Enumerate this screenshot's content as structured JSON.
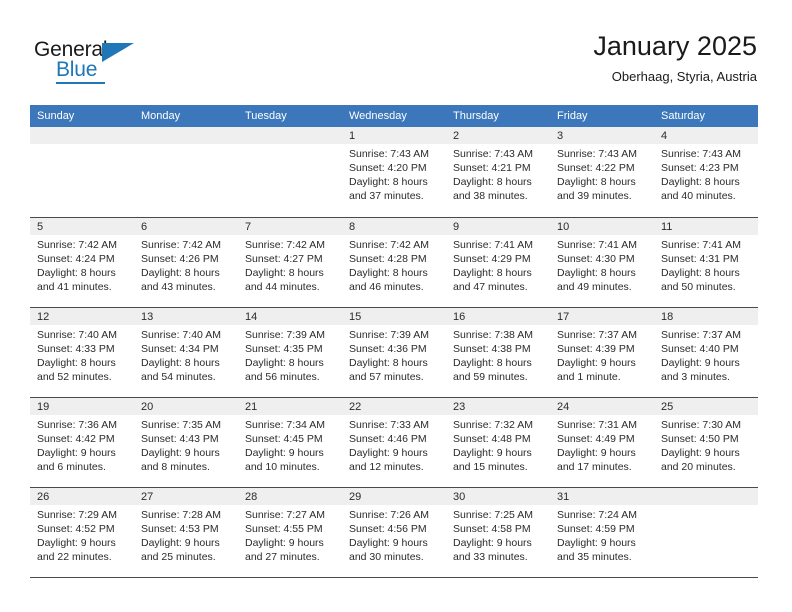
{
  "brand": {
    "name_part1": "General",
    "name_part2": "Blue",
    "logo_icon": "triangle-flag-icon",
    "accent_color": "#2077b8"
  },
  "header": {
    "title": "January 2025",
    "location": "Oberhaag, Styria, Austria",
    "header_bg_color": "#3b77ba"
  },
  "calendar": {
    "weekday_headers": [
      "Sunday",
      "Monday",
      "Tuesday",
      "Wednesday",
      "Thursday",
      "Friday",
      "Saturday"
    ],
    "weeks": [
      [
        {
          "day": "",
          "lines": []
        },
        {
          "day": "",
          "lines": []
        },
        {
          "day": "",
          "lines": []
        },
        {
          "day": "1",
          "lines": [
            "Sunrise: 7:43 AM",
            "Sunset: 4:20 PM",
            "Daylight: 8 hours",
            "and 37 minutes."
          ]
        },
        {
          "day": "2",
          "lines": [
            "Sunrise: 7:43 AM",
            "Sunset: 4:21 PM",
            "Daylight: 8 hours",
            "and 38 minutes."
          ]
        },
        {
          "day": "3",
          "lines": [
            "Sunrise: 7:43 AM",
            "Sunset: 4:22 PM",
            "Daylight: 8 hours",
            "and 39 minutes."
          ]
        },
        {
          "day": "4",
          "lines": [
            "Sunrise: 7:43 AM",
            "Sunset: 4:23 PM",
            "Daylight: 8 hours",
            "and 40 minutes."
          ]
        }
      ],
      [
        {
          "day": "5",
          "lines": [
            "Sunrise: 7:42 AM",
            "Sunset: 4:24 PM",
            "Daylight: 8 hours",
            "and 41 minutes."
          ]
        },
        {
          "day": "6",
          "lines": [
            "Sunrise: 7:42 AM",
            "Sunset: 4:26 PM",
            "Daylight: 8 hours",
            "and 43 minutes."
          ]
        },
        {
          "day": "7",
          "lines": [
            "Sunrise: 7:42 AM",
            "Sunset: 4:27 PM",
            "Daylight: 8 hours",
            "and 44 minutes."
          ]
        },
        {
          "day": "8",
          "lines": [
            "Sunrise: 7:42 AM",
            "Sunset: 4:28 PM",
            "Daylight: 8 hours",
            "and 46 minutes."
          ]
        },
        {
          "day": "9",
          "lines": [
            "Sunrise: 7:41 AM",
            "Sunset: 4:29 PM",
            "Daylight: 8 hours",
            "and 47 minutes."
          ]
        },
        {
          "day": "10",
          "lines": [
            "Sunrise: 7:41 AM",
            "Sunset: 4:30 PM",
            "Daylight: 8 hours",
            "and 49 minutes."
          ]
        },
        {
          "day": "11",
          "lines": [
            "Sunrise: 7:41 AM",
            "Sunset: 4:31 PM",
            "Daylight: 8 hours",
            "and 50 minutes."
          ]
        }
      ],
      [
        {
          "day": "12",
          "lines": [
            "Sunrise: 7:40 AM",
            "Sunset: 4:33 PM",
            "Daylight: 8 hours",
            "and 52 minutes."
          ]
        },
        {
          "day": "13",
          "lines": [
            "Sunrise: 7:40 AM",
            "Sunset: 4:34 PM",
            "Daylight: 8 hours",
            "and 54 minutes."
          ]
        },
        {
          "day": "14",
          "lines": [
            "Sunrise: 7:39 AM",
            "Sunset: 4:35 PM",
            "Daylight: 8 hours",
            "and 56 minutes."
          ]
        },
        {
          "day": "15",
          "lines": [
            "Sunrise: 7:39 AM",
            "Sunset: 4:36 PM",
            "Daylight: 8 hours",
            "and 57 minutes."
          ]
        },
        {
          "day": "16",
          "lines": [
            "Sunrise: 7:38 AM",
            "Sunset: 4:38 PM",
            "Daylight: 8 hours",
            "and 59 minutes."
          ]
        },
        {
          "day": "17",
          "lines": [
            "Sunrise: 7:37 AM",
            "Sunset: 4:39 PM",
            "Daylight: 9 hours",
            "and 1 minute."
          ]
        },
        {
          "day": "18",
          "lines": [
            "Sunrise: 7:37 AM",
            "Sunset: 4:40 PM",
            "Daylight: 9 hours",
            "and 3 minutes."
          ]
        }
      ],
      [
        {
          "day": "19",
          "lines": [
            "Sunrise: 7:36 AM",
            "Sunset: 4:42 PM",
            "Daylight: 9 hours",
            "and 6 minutes."
          ]
        },
        {
          "day": "20",
          "lines": [
            "Sunrise: 7:35 AM",
            "Sunset: 4:43 PM",
            "Daylight: 9 hours",
            "and 8 minutes."
          ]
        },
        {
          "day": "21",
          "lines": [
            "Sunrise: 7:34 AM",
            "Sunset: 4:45 PM",
            "Daylight: 9 hours",
            "and 10 minutes."
          ]
        },
        {
          "day": "22",
          "lines": [
            "Sunrise: 7:33 AM",
            "Sunset: 4:46 PM",
            "Daylight: 9 hours",
            "and 12 minutes."
          ]
        },
        {
          "day": "23",
          "lines": [
            "Sunrise: 7:32 AM",
            "Sunset: 4:48 PM",
            "Daylight: 9 hours",
            "and 15 minutes."
          ]
        },
        {
          "day": "24",
          "lines": [
            "Sunrise: 7:31 AM",
            "Sunset: 4:49 PM",
            "Daylight: 9 hours",
            "and 17 minutes."
          ]
        },
        {
          "day": "25",
          "lines": [
            "Sunrise: 7:30 AM",
            "Sunset: 4:50 PM",
            "Daylight: 9 hours",
            "and 20 minutes."
          ]
        }
      ],
      [
        {
          "day": "26",
          "lines": [
            "Sunrise: 7:29 AM",
            "Sunset: 4:52 PM",
            "Daylight: 9 hours",
            "and 22 minutes."
          ]
        },
        {
          "day": "27",
          "lines": [
            "Sunrise: 7:28 AM",
            "Sunset: 4:53 PM",
            "Daylight: 9 hours",
            "and 25 minutes."
          ]
        },
        {
          "day": "28",
          "lines": [
            "Sunrise: 7:27 AM",
            "Sunset: 4:55 PM",
            "Daylight: 9 hours",
            "and 27 minutes."
          ]
        },
        {
          "day": "29",
          "lines": [
            "Sunrise: 7:26 AM",
            "Sunset: 4:56 PM",
            "Daylight: 9 hours",
            "and 30 minutes."
          ]
        },
        {
          "day": "30",
          "lines": [
            "Sunrise: 7:25 AM",
            "Sunset: 4:58 PM",
            "Daylight: 9 hours",
            "and 33 minutes."
          ]
        },
        {
          "day": "31",
          "lines": [
            "Sunrise: 7:24 AM",
            "Sunset: 4:59 PM",
            "Daylight: 9 hours",
            "and 35 minutes."
          ]
        },
        {
          "day": "",
          "lines": []
        }
      ]
    ]
  }
}
